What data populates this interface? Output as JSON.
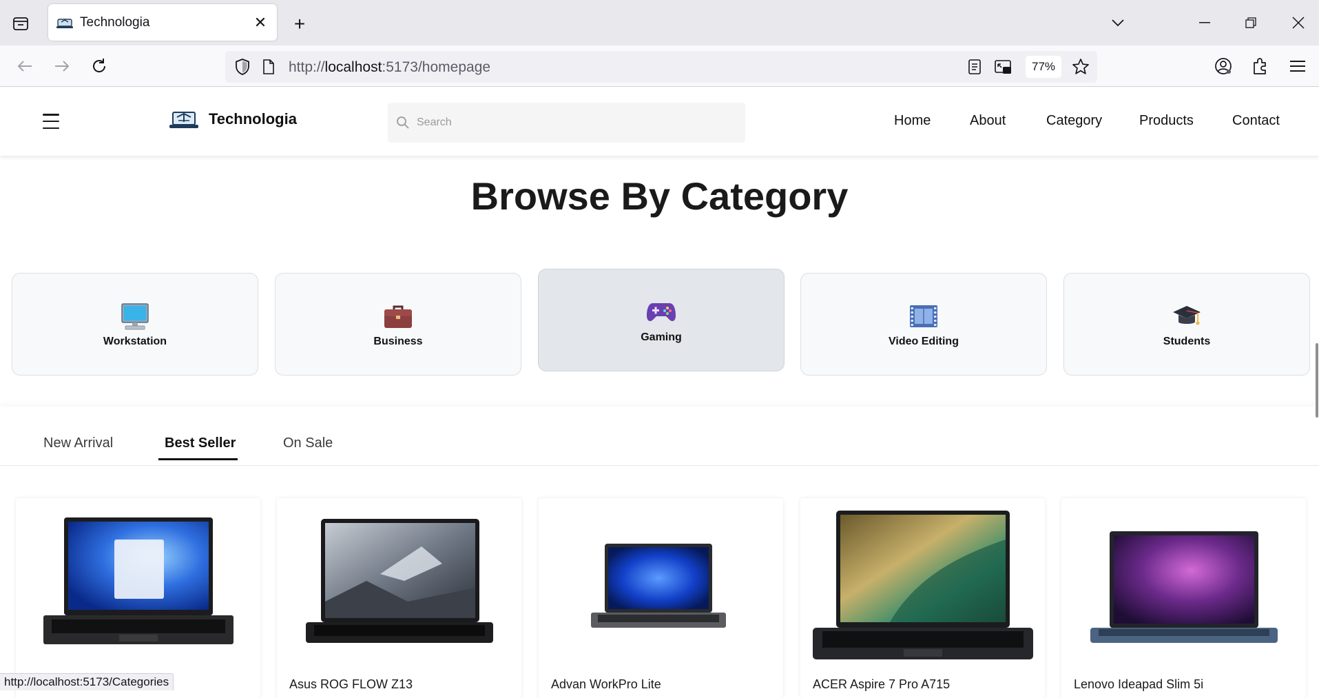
{
  "browser": {
    "tab_title": "Technologia",
    "url_scheme": "http://",
    "url_host": "localhost",
    "url_path": ":5173/homepage",
    "zoom": "77%",
    "status_url": "http://localhost:5173/Categories"
  },
  "header": {
    "brand_name": "Technologia",
    "search_placeholder": "Search",
    "nav": [
      "Home",
      "About",
      "Category",
      "Products",
      "Contact"
    ]
  },
  "browse": {
    "title": "Browse By Category",
    "categories": [
      {
        "label": "Workstation",
        "icon": "desktop-computer-icon"
      },
      {
        "label": "Business",
        "icon": "briefcase-icon"
      },
      {
        "label": "Gaming",
        "icon": "game-controller-icon"
      },
      {
        "label": "Video Editing",
        "icon": "film-frames-icon"
      },
      {
        "label": "Students",
        "icon": "graduation-cap-icon"
      }
    ],
    "active_category": "Gaming"
  },
  "product_tabs": {
    "items": [
      "New Arrival",
      "Best Seller",
      "On Sale"
    ],
    "active": "Best Seller"
  },
  "products": [
    {
      "name": ""
    },
    {
      "name": "Asus ROG FLOW Z13"
    },
    {
      "name": "Advan WorkPro Lite"
    },
    {
      "name": "ACER Aspire 7 Pro A715"
    },
    {
      "name": "Lenovo Ideapad Slim 5i"
    }
  ],
  "colors": {
    "chrome_bg": "#e9e9ed",
    "card_bg": "#f8f9fa",
    "card_active_bg": "#e3e6ea",
    "text_dark": "#111111"
  }
}
